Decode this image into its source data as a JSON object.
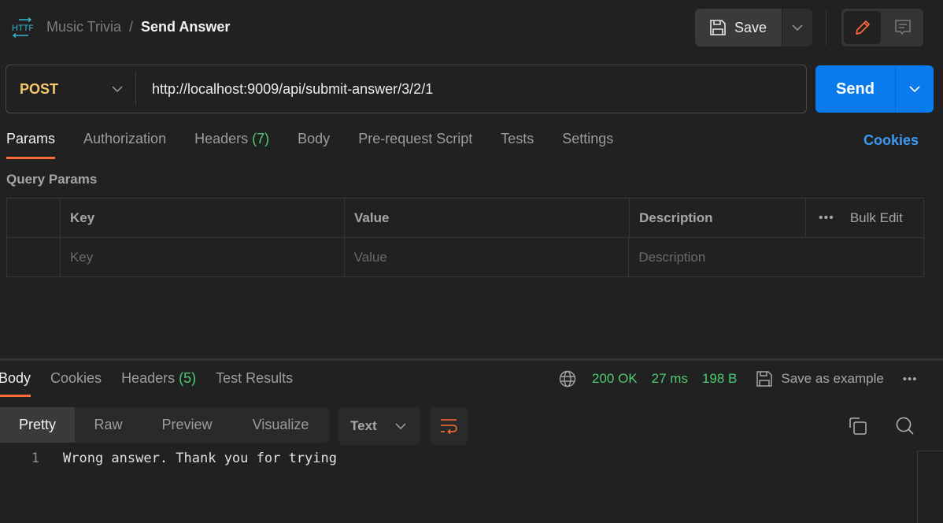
{
  "header": {
    "logo_icon": "http-icon",
    "breadcrumb": {
      "collection": "Music Trivia",
      "separator": "/",
      "request": "Send Answer"
    },
    "save_label": "Save",
    "save_icon": "floppy-disk-icon",
    "mode_buttons": [
      {
        "name": "edit",
        "icon": "pencil-icon",
        "active": true
      },
      {
        "name": "comments",
        "icon": "comment-icon",
        "active": false
      }
    ]
  },
  "request": {
    "method": "POST",
    "url": "http://localhost:9009/api/submit-answer/3/2/1",
    "send_label": "Send",
    "colors": {
      "method": "#f6c86e",
      "send": "#097bed",
      "accent": "#ff6c37"
    }
  },
  "request_tabs": [
    {
      "label": "Params",
      "count": null,
      "active": true
    },
    {
      "label": "Authorization",
      "count": null,
      "active": false
    },
    {
      "label": "Headers",
      "count": "(7)",
      "active": false
    },
    {
      "label": "Body",
      "count": null,
      "active": false
    },
    {
      "label": "Pre-request Script",
      "count": null,
      "active": false
    },
    {
      "label": "Tests",
      "count": null,
      "active": false
    },
    {
      "label": "Settings",
      "count": null,
      "active": false
    }
  ],
  "cookies_link": "Cookies",
  "query_params": {
    "title": "Query Params",
    "columns": {
      "key": "Key",
      "value": "Value",
      "description": "Description"
    },
    "bulk_edit": "Bulk Edit",
    "more": "•••",
    "placeholders": {
      "key": "Key",
      "value": "Value",
      "description": "Description"
    },
    "rows": []
  },
  "response": {
    "tabs": [
      {
        "label": "Body",
        "count": null,
        "active": true
      },
      {
        "label": "Cookies",
        "count": null,
        "active": false
      },
      {
        "label": "Headers",
        "count": "(5)",
        "active": false
      },
      {
        "label": "Test Results",
        "count": null,
        "active": false
      }
    ],
    "status": "200 OK",
    "time": "27 ms",
    "size": "198 B",
    "save_example": "Save as example",
    "more": "•••",
    "views": [
      "Pretty",
      "Raw",
      "Preview",
      "Visualize"
    ],
    "active_view": "Pretty",
    "format": "Text",
    "lines": [
      {
        "no": "1",
        "text": "Wrong answer. Thank you for trying"
      }
    ],
    "status_color": "#4ecb71"
  }
}
